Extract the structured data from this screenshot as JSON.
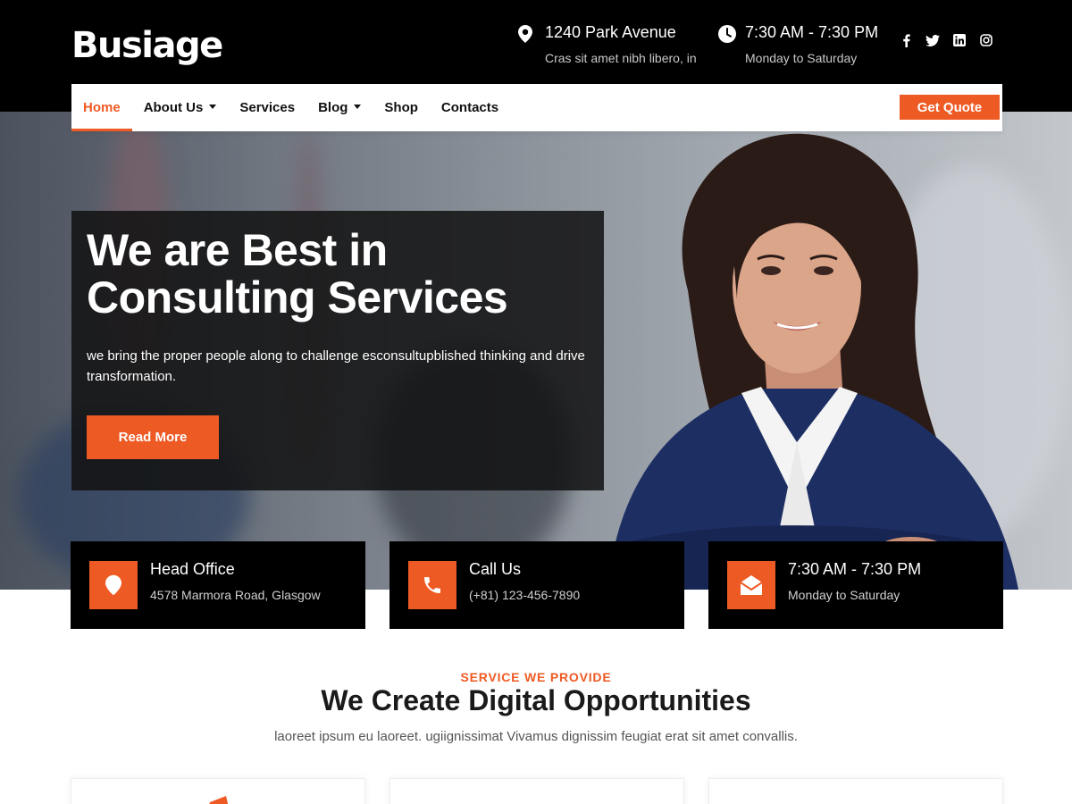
{
  "brand": {
    "logo": "Busiage",
    "accent_color": "#ee5a24"
  },
  "header": {
    "address": {
      "icon": "map-pin-icon",
      "main": "1240 Park Avenue",
      "sub": "Cras sit amet nibh libero, in"
    },
    "hours": {
      "icon": "clock-icon",
      "main": "7:30 AM - 7:30 PM",
      "sub": "Monday to Saturday"
    },
    "socials": [
      "facebook-icon",
      "twitter-icon",
      "linkedin-icon",
      "instagram-icon"
    ]
  },
  "nav": {
    "items": [
      {
        "label": "Home",
        "active": true,
        "dropdown": false
      },
      {
        "label": "About Us",
        "active": false,
        "dropdown": true
      },
      {
        "label": "Services",
        "active": false,
        "dropdown": false
      },
      {
        "label": "Blog",
        "active": false,
        "dropdown": true
      },
      {
        "label": "Shop",
        "active": false,
        "dropdown": false
      },
      {
        "label": "Contacts",
        "active": false,
        "dropdown": false
      }
    ],
    "cta_label": "Get Quote"
  },
  "hero": {
    "title_line1": "We are Best in",
    "title_line2": "Consulting Services",
    "text": "we bring the proper people along to challenge esconsultupblished thinking and drive transformation.",
    "button_label": "Read More"
  },
  "info_cards": [
    {
      "icon": "map-pin-icon",
      "title": "Head Office",
      "sub": "4578 Marmora Road, Glasgow"
    },
    {
      "icon": "phone-icon",
      "title": "Call Us",
      "sub": "(+81) 123-456-7890"
    },
    {
      "icon": "envelope-open-icon",
      "title": "7:30 AM - 7:30 PM",
      "sub": "Monday to Saturday"
    }
  ],
  "services": {
    "eyebrow": "SERVICE WE PROVIDE",
    "title": "We Create Digital Opportunities",
    "text": "laoreet ipsum eu laoreet. ugiignissimat Vivamus dignissim feugiat erat sit amet convallis."
  }
}
